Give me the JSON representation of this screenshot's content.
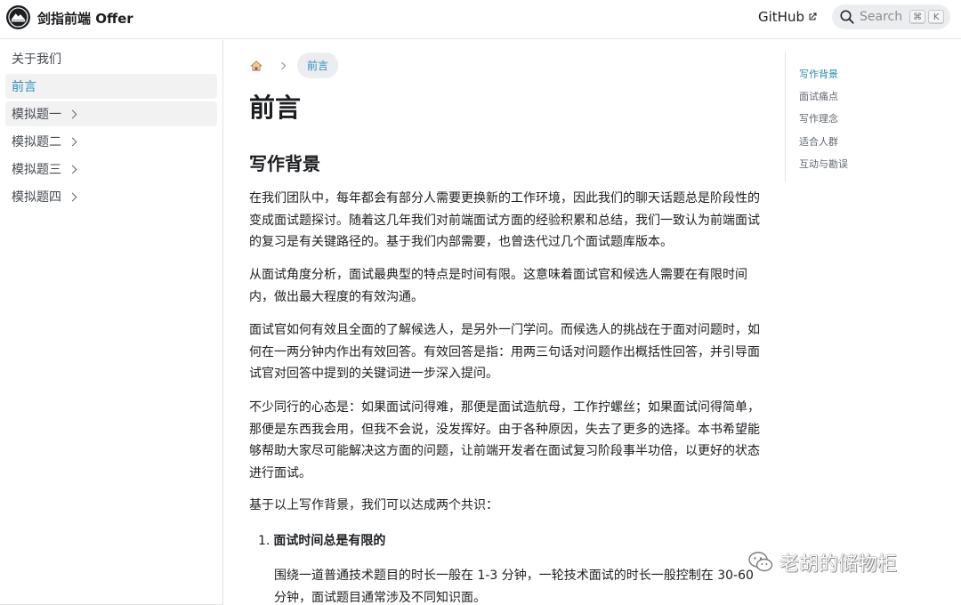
{
  "navbar": {
    "brand": "剑指前端 Offer",
    "github_label": "GitHub",
    "search": {
      "placeholder": "Search",
      "shortcut_keys": [
        "⌘",
        "K"
      ]
    }
  },
  "sidebar": {
    "items": [
      {
        "label": "关于我们",
        "state": "normal"
      },
      {
        "label": "前言",
        "state": "active"
      },
      {
        "label": "模拟题一",
        "state": "hovered",
        "has_children": true
      },
      {
        "label": "模拟题二",
        "state": "normal",
        "has_children": true
      },
      {
        "label": "模拟题三",
        "state": "normal",
        "has_children": true
      },
      {
        "label": "模拟题四",
        "state": "normal",
        "has_children": true
      }
    ]
  },
  "breadcrumb": {
    "current": "前言"
  },
  "article": {
    "title": "前言",
    "section_heading": "写作背景",
    "paragraphs": [
      "在我们团队中，每年都会有部分人需要更换新的工作环境，因此我们的聊天话题总是阶段性的变成面试题探讨。随着这几年我们对前端面试方面的经验积累和总结，我们一致认为前端面试的复习是有关键路径的。基于我们内部需要，也曾迭代过几个面试题库版本。",
      "从面试角度分析，面试最典型的特点是时间有限。这意味着面试官和候选人需要在有限时间内，做出最大程度的有效沟通。",
      "面试官如何有效且全面的了解候选人，是另外一门学问。而候选人的挑战在于面对问题时，如何在一两分钟内作出有效回答。有效回答是指：用两三句话对问题作出概括性回答，并引导面试官对回答中提到的关键词进一步深入提问。",
      "不少同行的心态是：如果面试问得难，那便是面试造航母，工作拧螺丝；如果面试问得简单，那便是东西我会用，但我不会说，没发挥好。由于各种原因，失去了更多的选择。本书希望能够帮助大家尽可能解决这方面的问题，让前端开发者在面试复习阶段事半功倍，以更好的状态进行面试。",
      "基于以上写作背景，我们可以达成两个共识："
    ],
    "list": [
      {
        "number": "1.",
        "title": "面试时间总是有限的",
        "body": "围绕一道普通技术题目的时长一般在 1-3 分钟，一轮技术面试的时长一般控制在 30-60 分钟，面试题目通常涉及不同知识面。"
      }
    ]
  },
  "toc": {
    "items": [
      {
        "label": "写作背景",
        "active": true
      },
      {
        "label": "面试痛点",
        "active": false
      },
      {
        "label": "写作理念",
        "active": false
      },
      {
        "label": "适合人群",
        "active": false
      },
      {
        "label": "互动与勘误",
        "active": false
      }
    ]
  },
  "watermark": {
    "text": "老胡的储物柜"
  },
  "colors": {
    "accent": "#2b8fb4",
    "text": "#1c1e21",
    "muted": "#606770",
    "sidebar_active_bg": "#f2f2f3",
    "border": "#e3e3e3"
  }
}
